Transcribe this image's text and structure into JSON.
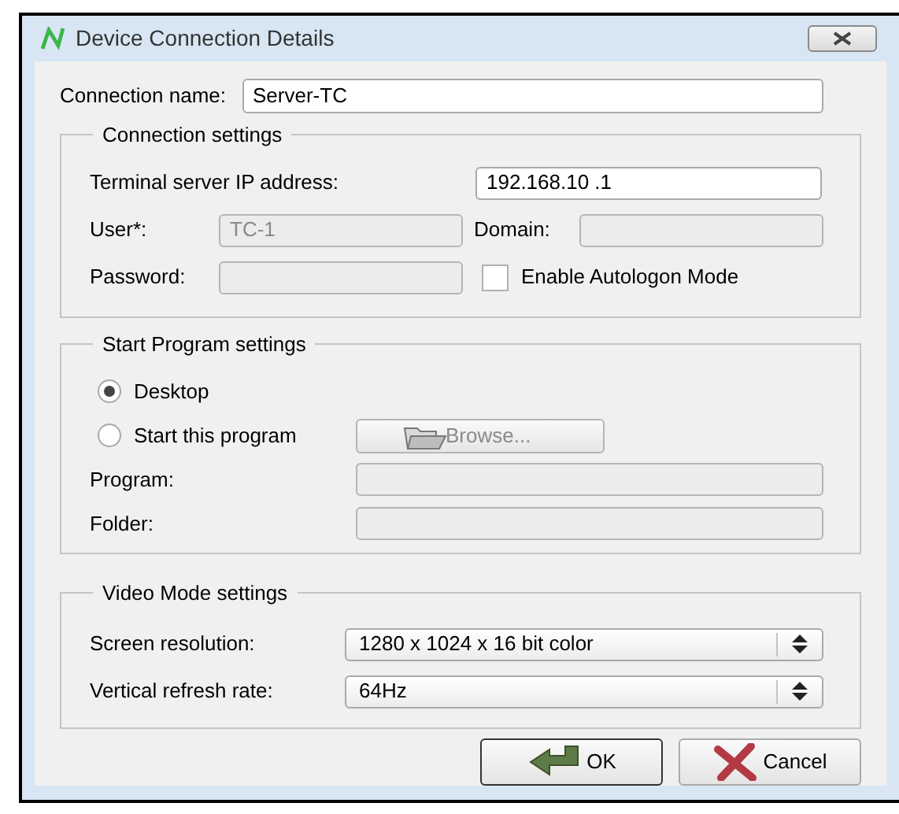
{
  "window": {
    "title": "Device Connection Details"
  },
  "connection_name": {
    "label": "Connection name:",
    "value": "Server-TC"
  },
  "connection_settings": {
    "title": "Connection settings",
    "ip": {
      "label": "Terminal server IP address:",
      "value": "192.168.10 .1",
      "disabled": false
    },
    "user": {
      "label": "User*:",
      "value": "TC-1",
      "disabled": true
    },
    "domain": {
      "label": "Domain:",
      "disabled": true
    },
    "password": {
      "label": "Password:",
      "disabled": true
    },
    "autologon": {
      "label": "Enable Autologon Mode",
      "checked": false
    }
  },
  "start_program": {
    "title": "Start Program settings",
    "options": [
      {
        "label": "Desktop",
        "selected": true
      },
      {
        "label": "Start this program",
        "selected": false
      }
    ],
    "browse": {
      "label": "Browse...",
      "disabled": true
    },
    "program": {
      "label": "Program:",
      "disabled": true
    },
    "folder": {
      "label": "Folder:",
      "disabled": true
    }
  },
  "video_mode": {
    "title": "Video Mode settings",
    "resolution": {
      "label": "Screen resolution:",
      "value": "1280 x 1024 x 16 bit color"
    },
    "refresh": {
      "label": "Vertical refresh rate:",
      "value": "64Hz"
    }
  },
  "buttons": [
    {
      "kind": "ok",
      "label": "OK"
    },
    {
      "kind": "cancel",
      "label": "Cancel"
    }
  ]
}
